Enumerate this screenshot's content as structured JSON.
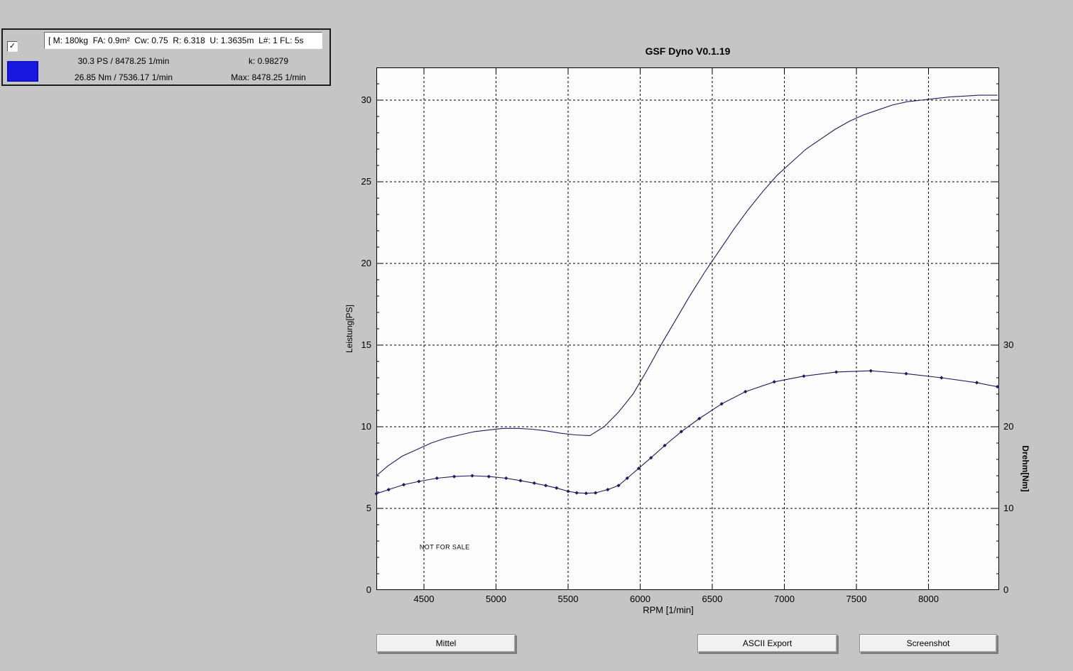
{
  "info_panel": {
    "checkbox_checked": true,
    "check_glyph": "✓",
    "params": "[ M: 180kg  FA: 0.9m²  Cw: 0.75  R: 6.318  U: 1.3635m  L#: 1 FL: 5s",
    "swatch_color": "#1717dd",
    "stats": {
      "power_peak": "30.3 PS / 8478.25 1/min",
      "k_value": "k: 0.98279",
      "torque_peak": "26.85 Nm / 7536.17 1/min",
      "max_rpm": "Max: 8478.25 1/min"
    }
  },
  "chart_data": {
    "type": "line",
    "title": "GSF Dyno V0.1.19",
    "xlabel": "RPM [1/min]",
    "ylabel_left": "Leistung[PS]",
    "ylabel_right": "Drehm[Nm]",
    "watermark": "NOT FOR SALE",
    "grid": "dashed",
    "bg_color": "#fdfdfd",
    "line_color": "#1b1b60",
    "x_range": [
      4170,
      8490
    ],
    "y_left_range": [
      0,
      32
    ],
    "y_right_range": [
      0,
      64
    ],
    "x_ticks": [
      4500,
      5000,
      5500,
      6000,
      6500,
      7000,
      7500,
      8000
    ],
    "y_left_ticks": [
      0,
      5,
      10,
      15,
      20,
      25,
      30
    ],
    "y_left_minor_step": 1,
    "y_right_ticks": [
      0,
      10,
      20,
      30
    ],
    "y_right_major_step": 10,
    "y_right_minor_step": 2,
    "series": [
      {
        "id": "power",
        "axis": "left",
        "marker": false,
        "points": [
          [
            4170,
            7.0
          ],
          [
            4250,
            7.6
          ],
          [
            4350,
            8.2
          ],
          [
            4450,
            8.6
          ],
          [
            4550,
            9.0
          ],
          [
            4650,
            9.3
          ],
          [
            4750,
            9.5
          ],
          [
            4850,
            9.7
          ],
          [
            4950,
            9.8
          ],
          [
            5050,
            9.9
          ],
          [
            5150,
            9.9
          ],
          [
            5250,
            9.85
          ],
          [
            5350,
            9.75
          ],
          [
            5450,
            9.6
          ],
          [
            5550,
            9.5
          ],
          [
            5650,
            9.45
          ],
          [
            5750,
            10.0
          ],
          [
            5850,
            10.9
          ],
          [
            5950,
            12.0
          ],
          [
            6050,
            13.5
          ],
          [
            6150,
            15.1
          ],
          [
            6250,
            16.6
          ],
          [
            6350,
            18.1
          ],
          [
            6450,
            19.5
          ],
          [
            6550,
            20.8
          ],
          [
            6650,
            22.1
          ],
          [
            6750,
            23.3
          ],
          [
            6850,
            24.4
          ],
          [
            6950,
            25.4
          ],
          [
            7050,
            26.2
          ],
          [
            7150,
            27.0
          ],
          [
            7250,
            27.6
          ],
          [
            7350,
            28.2
          ],
          [
            7450,
            28.7
          ],
          [
            7550,
            29.1
          ],
          [
            7650,
            29.4
          ],
          [
            7750,
            29.7
          ],
          [
            7850,
            29.9
          ],
          [
            7950,
            30.0
          ],
          [
            8050,
            30.1
          ],
          [
            8150,
            30.2
          ],
          [
            8250,
            30.25
          ],
          [
            8350,
            30.3
          ],
          [
            8478,
            30.3
          ]
        ]
      },
      {
        "id": "torque",
        "axis": "right",
        "marker": true,
        "points": [
          [
            4170,
            11.8
          ],
          [
            4255,
            12.3
          ],
          [
            4360,
            12.9
          ],
          [
            4465,
            13.3
          ],
          [
            4590,
            13.7
          ],
          [
            4710,
            13.9
          ],
          [
            4835,
            14.0
          ],
          [
            4950,
            13.9
          ],
          [
            5070,
            13.7
          ],
          [
            5170,
            13.4
          ],
          [
            5265,
            13.1
          ],
          [
            5345,
            12.8
          ],
          [
            5420,
            12.5
          ],
          [
            5500,
            12.1
          ],
          [
            5560,
            11.9
          ],
          [
            5625,
            11.85
          ],
          [
            5690,
            11.9
          ],
          [
            5775,
            12.3
          ],
          [
            5850,
            12.8
          ],
          [
            5910,
            13.7
          ],
          [
            5990,
            14.9
          ],
          [
            6075,
            16.2
          ],
          [
            6170,
            17.7
          ],
          [
            6285,
            19.4
          ],
          [
            6410,
            21.0
          ],
          [
            6565,
            22.8
          ],
          [
            6730,
            24.3
          ],
          [
            6930,
            25.5
          ],
          [
            7135,
            26.2
          ],
          [
            7360,
            26.7
          ],
          [
            7600,
            26.85
          ],
          [
            7845,
            26.5
          ],
          [
            8090,
            26.0
          ],
          [
            8335,
            25.4
          ],
          [
            8478,
            24.9
          ]
        ]
      }
    ]
  },
  "buttons": {
    "mittel": "Mittel",
    "ascii_export": "ASCII Export",
    "screenshot": "Screenshot"
  }
}
